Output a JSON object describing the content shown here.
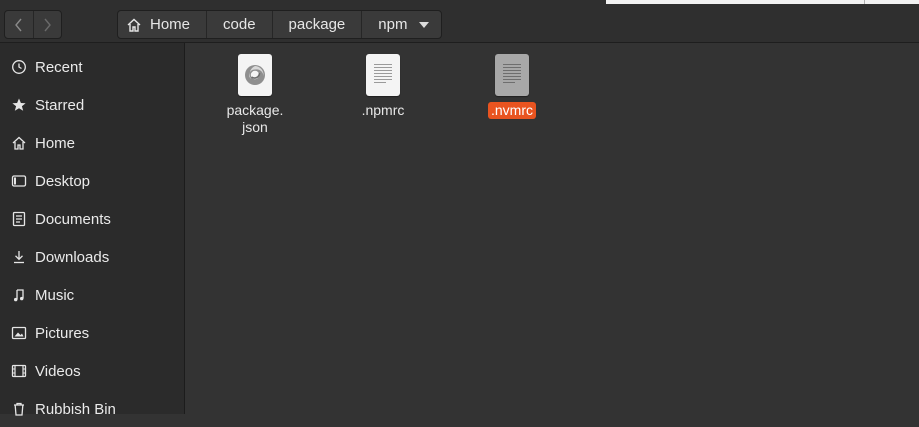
{
  "nav": {
    "back_icon": "chevron-left-icon",
    "forward_icon": "chevron-right-icon"
  },
  "path": {
    "crumbs": [
      "Home",
      "code",
      "package",
      "npm"
    ],
    "home_icon": "home-icon",
    "menu_icon": "caret-down-icon"
  },
  "sidebar": {
    "items": [
      {
        "label": "Recent",
        "icon": "clock-icon"
      },
      {
        "label": "Starred",
        "icon": "star-icon"
      },
      {
        "label": "Home",
        "icon": "home-icon"
      },
      {
        "label": "Desktop",
        "icon": "desktop-icon"
      },
      {
        "label": "Documents",
        "icon": "document-icon"
      },
      {
        "label": "Downloads",
        "icon": "download-icon"
      },
      {
        "label": "Music",
        "icon": "music-icon"
      },
      {
        "label": "Pictures",
        "icon": "picture-icon"
      },
      {
        "label": "Videos",
        "icon": "video-icon"
      },
      {
        "label": "Rubbish Bin",
        "icon": "trash-icon"
      }
    ]
  },
  "files": [
    {
      "name_line1": "package.",
      "name_line2": "json",
      "icon": "json-file-icon"
    },
    {
      "name": ".npmrc",
      "icon": "text-file-icon"
    },
    {
      "name": ".nvmrc",
      "icon": "text-file-icon",
      "selected": true
    }
  ],
  "colors": {
    "accent": "#e95420",
    "background": "#333333",
    "sidebar": "#2b2b2b"
  }
}
